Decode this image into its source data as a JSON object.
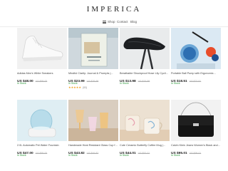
{
  "store": {
    "logo": "IMPERICA"
  },
  "nav": {
    "menu_label": "Shop",
    "contact_label": "Contact",
    "blog_label": "Blog"
  },
  "products": [
    {
      "title": "Adidas Men's White Sneakers",
      "price": "US $48.00",
      "old_price": "US $58.00",
      "stock": "In Stock"
    },
    {
      "title": "Mindful Clarity: Journal & Prompts |...",
      "price": "US $23.99",
      "old_price": "US $29.99",
      "stock": "In Stock",
      "rating": "★★★★★",
      "rating_count": "(53)"
    },
    {
      "title": "Breathable Shockproof Hose Lily Cycling...",
      "price": "US $13.98",
      "old_price": "US $19.98",
      "stock": "In Stock"
    },
    {
      "title": "Portable Ball Pump with Ergonomic...",
      "price": "US $18.51",
      "old_price": "US $22.51",
      "stock": "In Stock"
    },
    {
      "title": "2.0L Automatic Pet Water Fountain",
      "price": "US $47.00",
      "old_price": "US $55.00",
      "stock": "In Stock"
    },
    {
      "title": "Handmade Heat Resistant Glass Cup for...",
      "price": "US $43.82",
      "old_price": "US $49.82",
      "stock": "In Stock"
    },
    {
      "title": "Cute Ceramic Butterfly Coffee Mug |...",
      "price": "US $44.01",
      "old_price": "US $52.01",
      "stock": "In Stock"
    },
    {
      "title": "Calvin Klein Jeans Women's Black and...",
      "price": "US $95.01",
      "old_price": "US $99.01",
      "stock": "In Stock"
    }
  ],
  "colors": {
    "in_stock": "#2e9b3d",
    "stars": "#f0a21f",
    "price": "#222222"
  }
}
